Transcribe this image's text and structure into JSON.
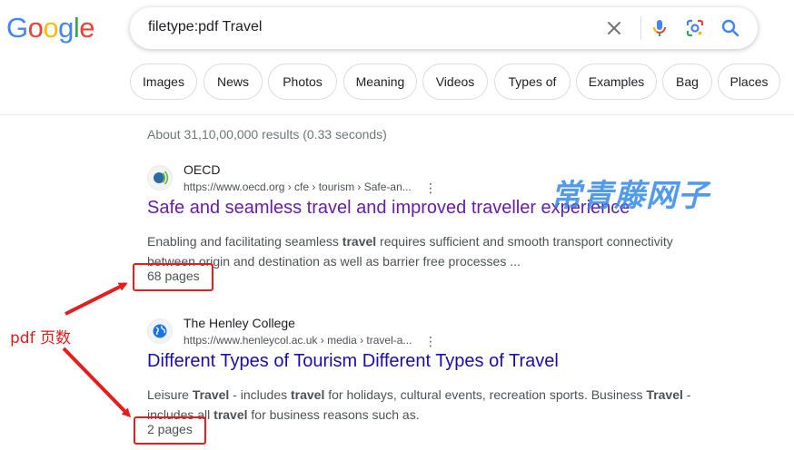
{
  "logo": {
    "letters": [
      "G",
      "o",
      "o",
      "g",
      "l",
      "e"
    ],
    "colors": [
      "#4285F4",
      "#EA4335",
      "#FBBC05",
      "#4285F4",
      "#34A853",
      "#EA4335"
    ]
  },
  "search": {
    "query": "filetype:pdf Travel"
  },
  "icons": {
    "clear": "close-icon",
    "voice": "microphone-icon",
    "lens": "lens-icon",
    "search": "search-icon"
  },
  "chips": [
    "Images",
    "News",
    "Photos",
    "Meaning",
    "Videos",
    "Types of",
    "Examples",
    "Bag",
    "Places"
  ],
  "stats": "About 31,10,00,000 results (0.33 seconds)",
  "results": [
    {
      "site": "OECD",
      "url": "https://www.oecd.org › cfe › tourism › Safe-an...",
      "title": "Safe and seamless travel and improved traveller experience",
      "snippet": [
        {
          "t": "Enabling and facilitating seamless "
        },
        {
          "t": "travel",
          "b": true
        },
        {
          "t": " requires sufficient and smooth transport connectivity between origin and destination as well as barrier free processes ..."
        }
      ],
      "pages": "68 pages",
      "title_color": "#681da8"
    },
    {
      "site": "The Henley College",
      "url": "https://www.henleycol.ac.uk › media › travel-a...",
      "title": "Different Types of Tourism Different Types of Travel",
      "snippet": [
        {
          "t": "Leisure "
        },
        {
          "t": "Travel",
          "b": true
        },
        {
          "t": " - includes "
        },
        {
          "t": "travel",
          "b": true
        },
        {
          "t": " for holidays, cultural events, recreation sports. Business "
        },
        {
          "t": "Travel",
          "b": true
        },
        {
          "t": " - includes all "
        },
        {
          "t": "travel",
          "b": true
        },
        {
          "t": " for business reasons such as."
        }
      ],
      "pages": "2 pages",
      "title_color": "#1a0dab"
    }
  ],
  "annotation": {
    "label": "pdf 页数",
    "color": "#e61d1d"
  },
  "watermark": "常青藤网子"
}
